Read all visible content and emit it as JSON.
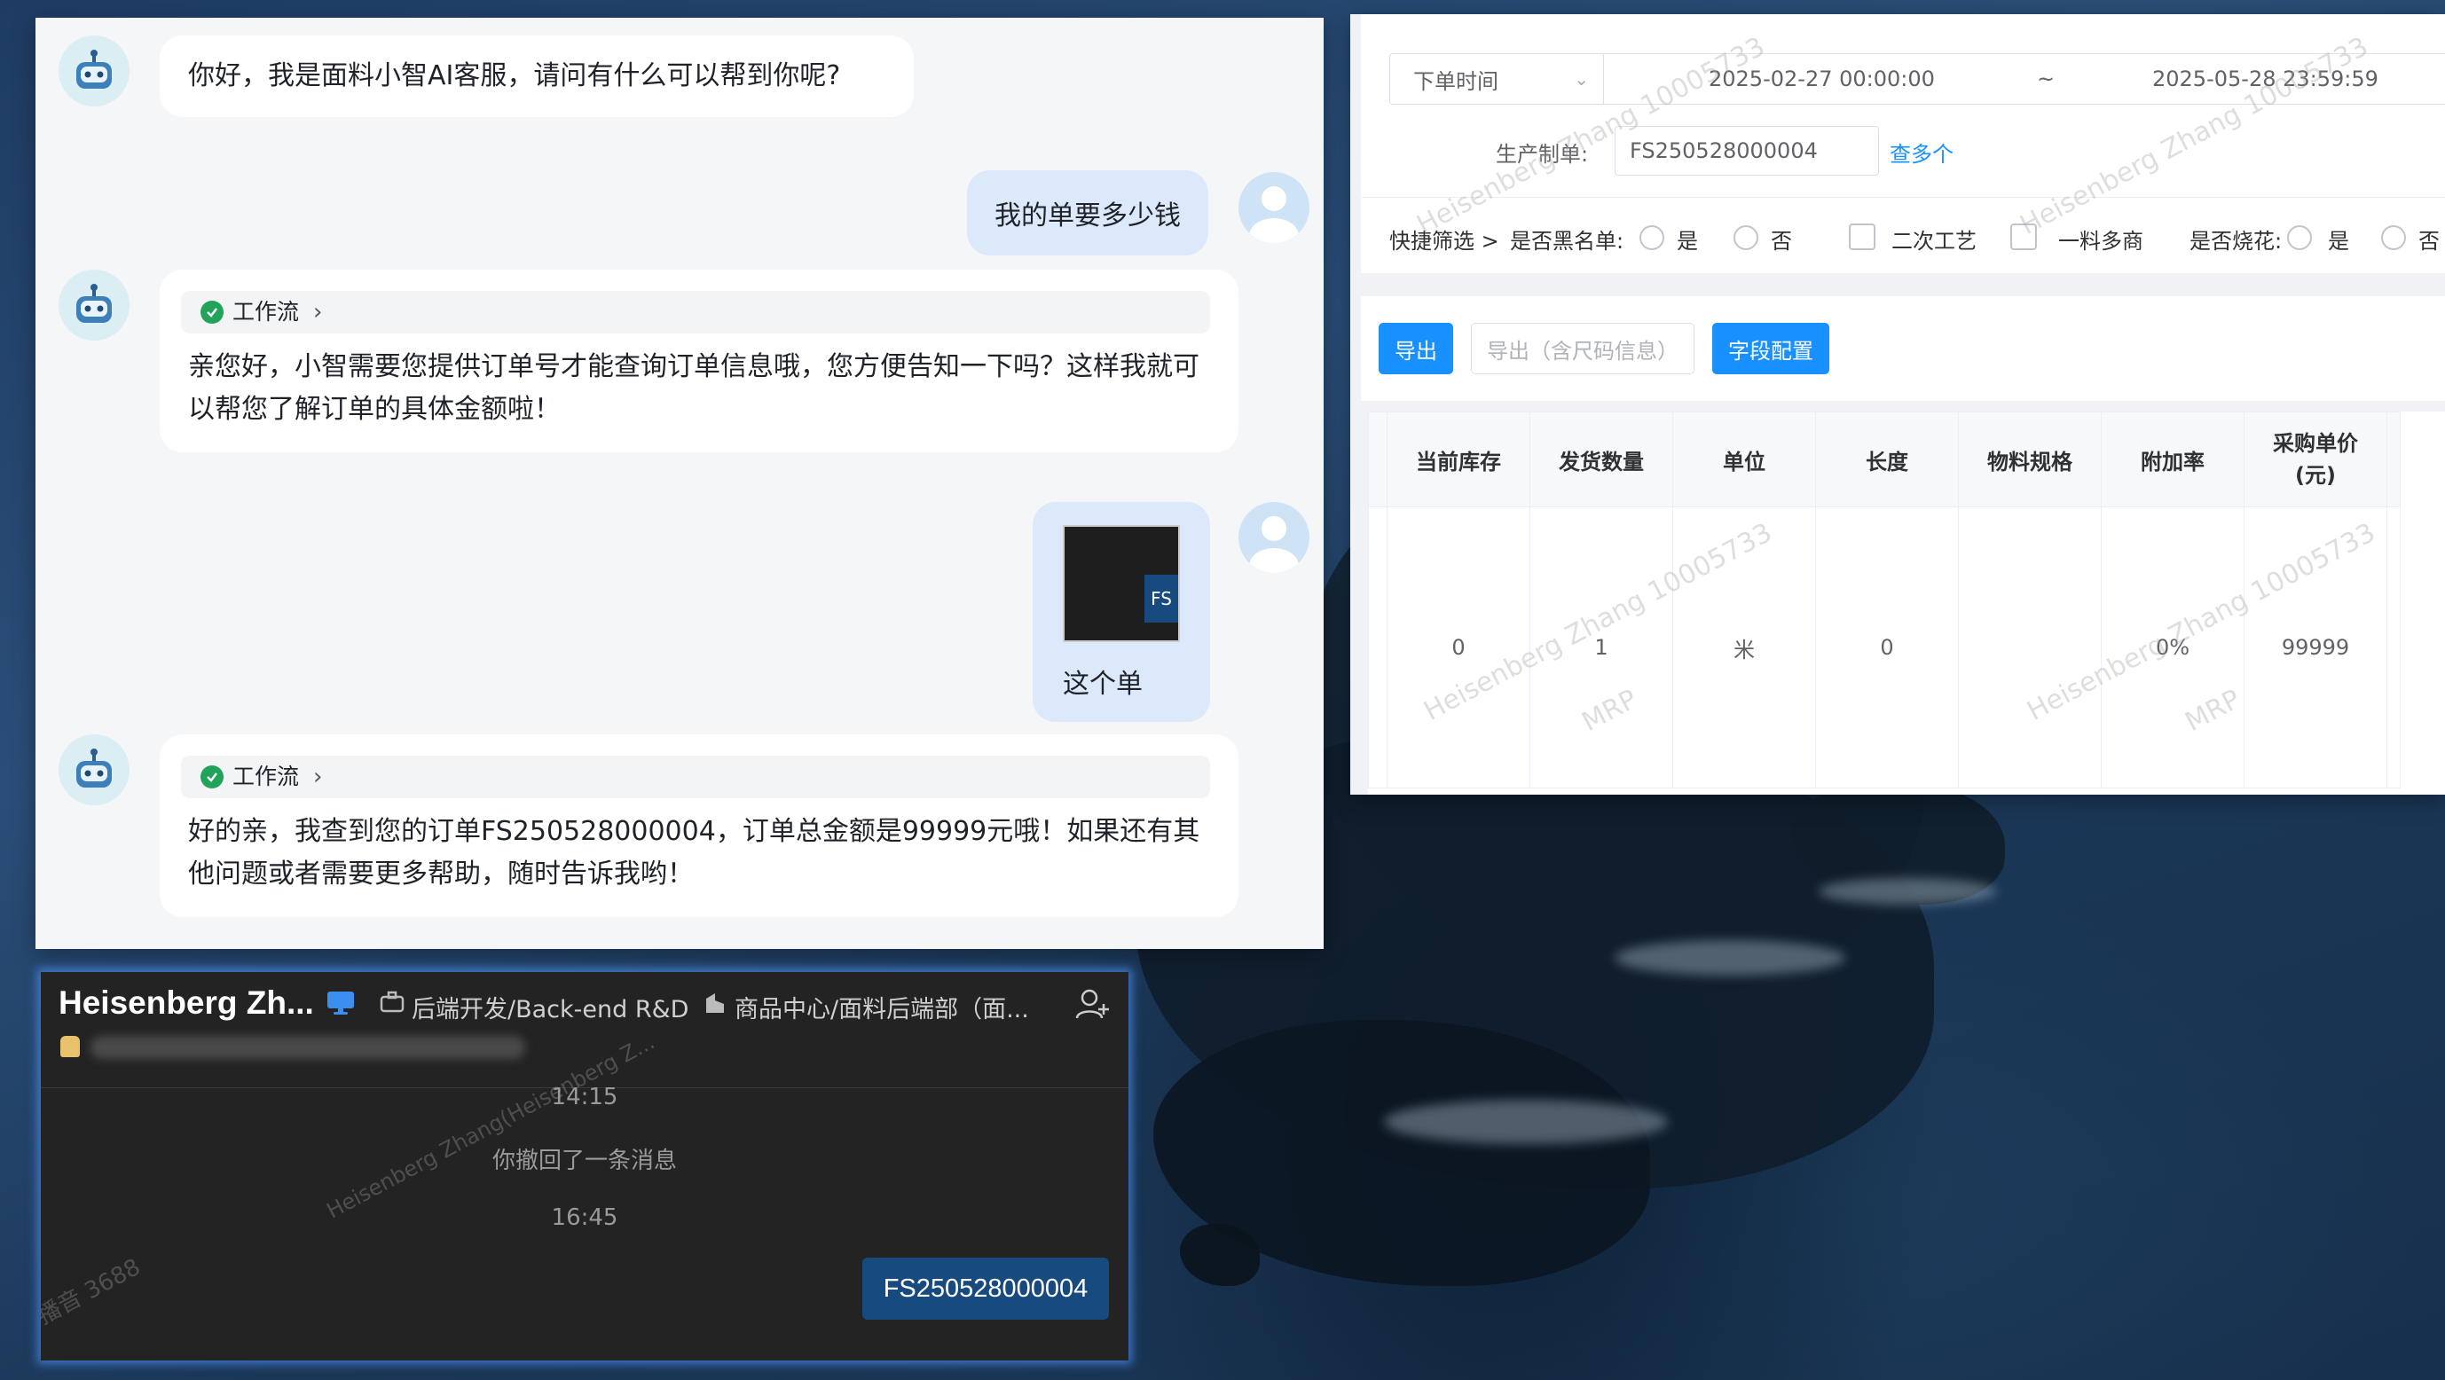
{
  "chat": {
    "messages": [
      {
        "role": "bot",
        "text": "你好，我是面料小智AI客服，请问有什么可以帮到你呢?"
      },
      {
        "role": "user",
        "text": "我的单要多少钱"
      },
      {
        "role": "bot",
        "workflow_label": "工作流",
        "text_line1": "亲您好，小智需要您提供订单号才能查询订单信息哦，您方便告知一下吗？这样我就可",
        "text_line2": "以帮您了解订单的具体金额啦！"
      },
      {
        "role": "user",
        "thumb_text": "FS",
        "text": "这个单"
      },
      {
        "role": "bot",
        "workflow_label": "工作流",
        "text_line1": "好的亲，我查到您的订单FS250528000004，订单总金额是99999元哦！如果还有其",
        "text_line2": "他问题或者需要更多帮助，随时告诉我哟！"
      }
    ]
  },
  "erp": {
    "date_select": "下单时间",
    "date_start": "2025-02-27 00:00:00",
    "date_sep": "~",
    "date_end": "2025-05-28 23:59:59",
    "production_label": "生产制单:",
    "production_value": "FS250528000004",
    "more_link": "查多个",
    "quick_filter": "快捷筛选 >",
    "blacklist_label": "是否黑名单:",
    "yes": "是",
    "no": "否",
    "secondary_process": "二次工艺",
    "multi_supplier": "一料多商",
    "burnout_label": "是否烧花:",
    "burnout_yes": "是",
    "burnout_no": "否",
    "btn_export": "导出",
    "btn_export_size": "导出（含尺码信息）",
    "btn_field_config": "字段配置",
    "columns": [
      "当前库存",
      "发货数量",
      "单位",
      "长度",
      "物料规格",
      "附加率",
      "采购单价\n(元)"
    ],
    "row": [
      "0",
      "1",
      "米",
      "0",
      "",
      "0%",
      "99999"
    ],
    "watermark1": "Heisenberg Zhang 10005733",
    "watermark2": "MRP",
    "colors": {
      "primary": "#1890ff",
      "border": "#dcdfe6"
    }
  },
  "im": {
    "title": "Heisenberg Zh...",
    "dept1": "后端开发/Back-end R&D",
    "dept2": "商品中心/面料后端部（面...",
    "time1": "14:15",
    "recall": "你撤回了一条消息",
    "time2": "16:45",
    "sent_message": "FS250528000004",
    "watermark": "Heisenberg Zhang(Heisenberg Z...",
    "watermark_left": "播音 3688",
    "accent": "#174a7e"
  }
}
